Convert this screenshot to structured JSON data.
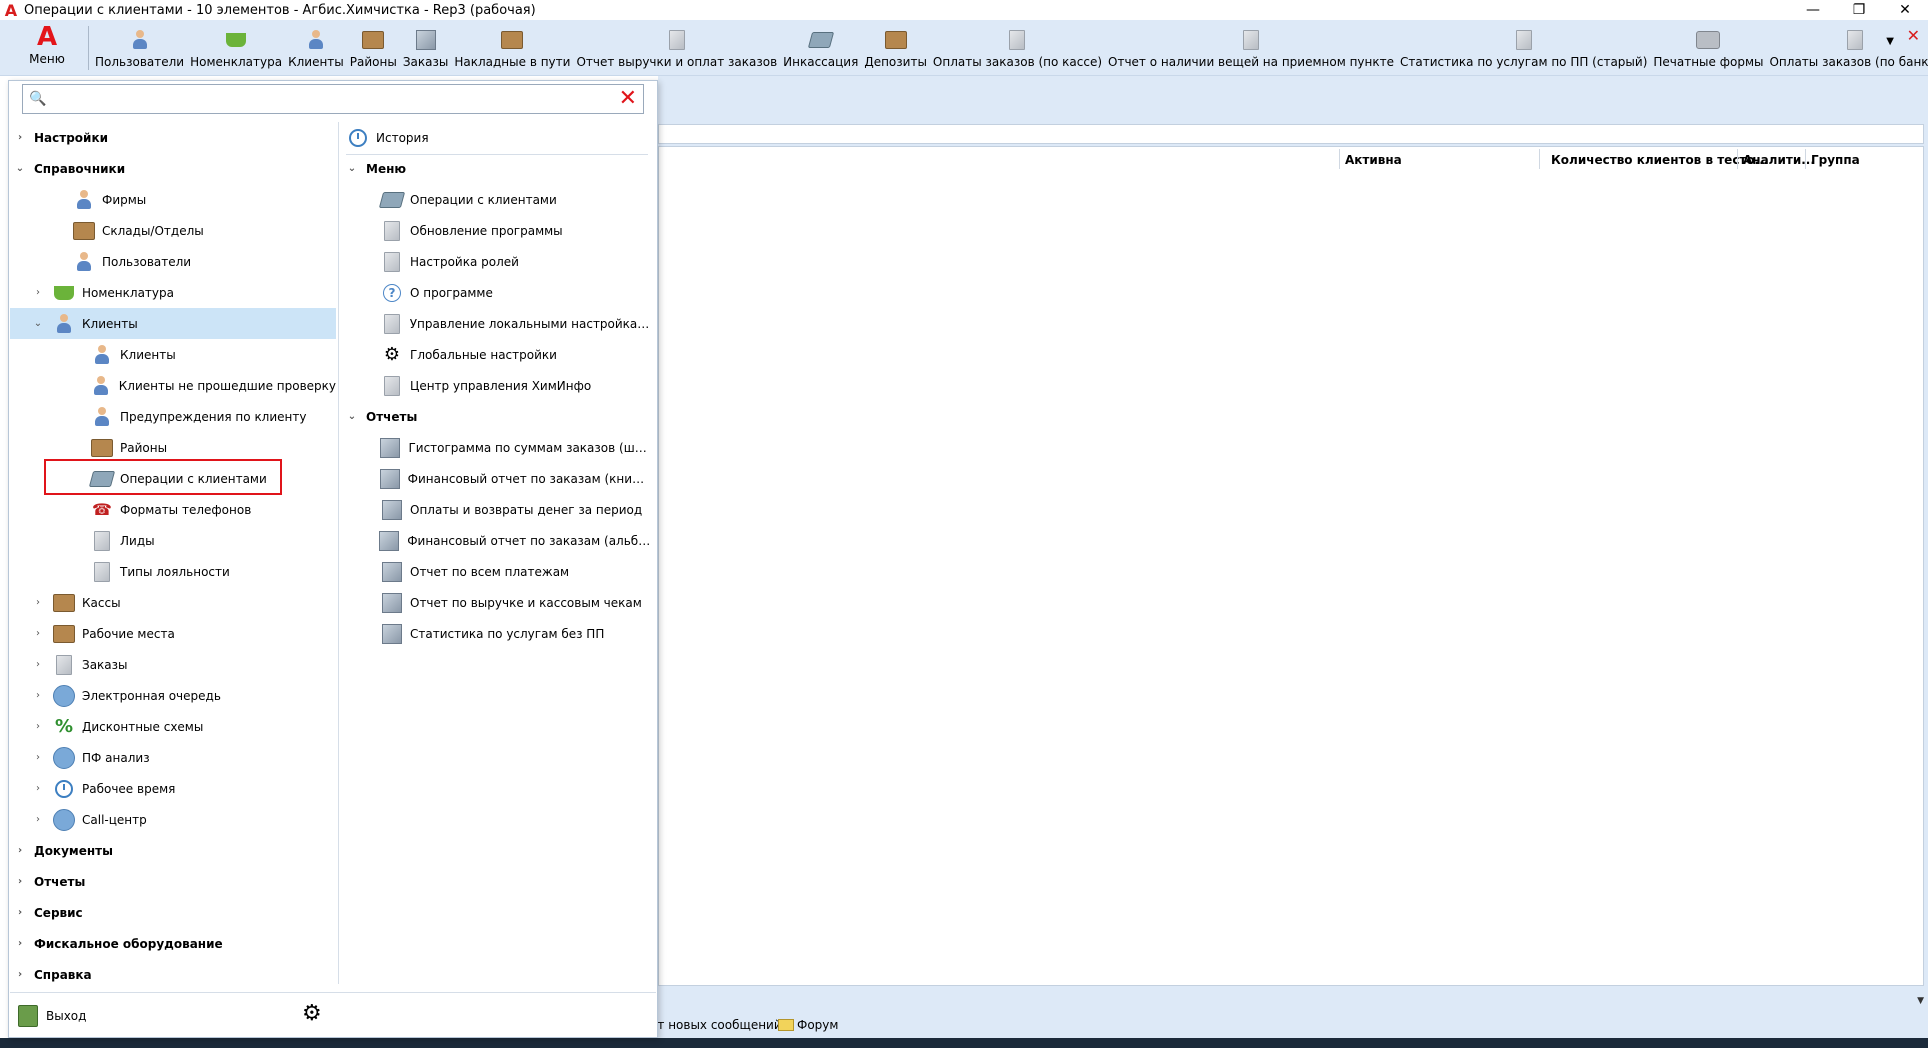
{
  "window": {
    "title": "Операции с клиентами - 10 элементов - Агбис.Химчистка - Rep3 (рабочая)",
    "controls": [
      "—",
      "❐",
      "✕"
    ]
  },
  "toolbar": {
    "menu_label": "Меню",
    "items": [
      {
        "label": "Пользователи",
        "icon": "users-icon"
      },
      {
        "label": "Номенклатура",
        "icon": "basket-icon"
      },
      {
        "label": "Клиенты",
        "icon": "client-icon"
      },
      {
        "label": "Районы",
        "icon": "district-icon"
      },
      {
        "label": "Заказы",
        "icon": "orders-icon"
      },
      {
        "label": "Накладные в пути",
        "icon": "truck-icon"
      },
      {
        "label": "Отчет выручки и оплат заказов",
        "icon": "document-icon"
      },
      {
        "label": "Инкассация",
        "icon": "cash-icon"
      },
      {
        "label": "Депозиты",
        "icon": "deposit-icon"
      },
      {
        "label": "Оплаты заказов (по кассе)",
        "icon": "document-icon"
      },
      {
        "label": "Отчет о наличии вещей на приемном пункте",
        "icon": "document-icon"
      },
      {
        "label": "Статистика по услугам по ПП (старый)",
        "icon": "document-icon"
      },
      {
        "label": "Печатные формы",
        "icon": "printer-icon"
      },
      {
        "label": "Оплаты заказов (по банку)",
        "icon": "document-icon"
      }
    ]
  },
  "search": {
    "value": "",
    "placeholder": ""
  },
  "tree": {
    "items": [
      {
        "label": "Настройки",
        "level": 0,
        "chev": "›",
        "bold": true
      },
      {
        "label": "Справочники",
        "level": 0,
        "chev": "⌄",
        "bold": true
      },
      {
        "label": "Фирмы",
        "level": 2,
        "icon": "firm-icon"
      },
      {
        "label": "Склады/Отделы",
        "level": 2,
        "icon": "warehouse-icon"
      },
      {
        "label": "Пользователи",
        "level": 2,
        "icon": "users-icon"
      },
      {
        "label": "Номенклатура",
        "level": 1,
        "chev": "›",
        "icon": "basket-icon"
      },
      {
        "label": "Клиенты",
        "level": 1,
        "chev": "⌄",
        "icon": "client-icon",
        "selected": true
      },
      {
        "label": "Клиенты",
        "level": 3,
        "icon": "client-icon"
      },
      {
        "label": "Клиенты не прошедшие проверку",
        "level": 3,
        "icon": "client-warning-icon"
      },
      {
        "label": "Предупреждения по клиенту",
        "level": 3,
        "icon": "client-alert-icon"
      },
      {
        "label": "Районы",
        "level": 3,
        "icon": "district-icon"
      },
      {
        "label": "Операции с клиентами",
        "level": 3,
        "icon": "cash-icon"
      },
      {
        "label": "Форматы телефонов",
        "level": 3,
        "icon": "phone-icon"
      },
      {
        "label": "Лиды",
        "level": 3,
        "icon": "document-icon"
      },
      {
        "label": "Типы лояльности",
        "level": 3,
        "icon": "document-icon"
      },
      {
        "label": "Кассы",
        "level": 1,
        "chev": "›",
        "icon": "register-icon"
      },
      {
        "label": "Рабочие места",
        "level": 1,
        "chev": "›",
        "icon": "workplace-icon"
      },
      {
        "label": "Заказы",
        "level": 1,
        "chev": "›",
        "icon": "document-icon"
      },
      {
        "label": "Электронная очередь",
        "level": 1,
        "chev": "›",
        "icon": "queue-icon"
      },
      {
        "label": "Дисконтные схемы",
        "level": 1,
        "chev": "›",
        "icon": "percent-icon"
      },
      {
        "label": "ПФ анализ",
        "level": 1,
        "chev": "›",
        "icon": "analysis-icon"
      },
      {
        "label": "Рабочее время",
        "level": 1,
        "chev": "›",
        "icon": "clock-icon"
      },
      {
        "label": "Call-центр",
        "level": 1,
        "chev": "›",
        "icon": "phone-round-icon"
      },
      {
        "label": "Документы",
        "level": 0,
        "chev": "›",
        "bold": true
      },
      {
        "label": "Отчеты",
        "level": 0,
        "chev": "›",
        "bold": true
      },
      {
        "label": "Сервис",
        "level": 0,
        "chev": "›",
        "bold": true
      },
      {
        "label": "Фискальное оборудование",
        "level": 0,
        "chev": "›",
        "bold": true
      },
      {
        "label": "Справка",
        "level": 0,
        "chev": "›",
        "bold": true
      }
    ]
  },
  "right_panel": {
    "history_label": "История",
    "menu_section": "Меню",
    "menu_items": [
      {
        "label": "Операции с клиентами",
        "icon": "cash-icon"
      },
      {
        "label": "Обновление программы",
        "icon": "document-icon"
      },
      {
        "label": "Настройка ролей",
        "icon": "document-icon"
      },
      {
        "label": "О программе",
        "icon": "question-icon"
      },
      {
        "label": "Управление локальными настройками",
        "icon": "document-icon"
      },
      {
        "label": "Глобальные настройки",
        "icon": "settings-icon"
      },
      {
        "label": "Центр управления ХимИнфо",
        "icon": "document-icon"
      }
    ],
    "reports_section": "Отчеты",
    "report_items": [
      {
        "label": "Гистограмма по суммам заказов (шаг ...",
        "icon": "report-icon"
      },
      {
        "label": "Финансовый отчет по заказам (книжная)",
        "icon": "report-icon"
      },
      {
        "label": "Оплаты и возвраты денег за период",
        "icon": "report-icon"
      },
      {
        "label": "Финансовый отчет по заказам (альбомн...",
        "icon": "report-icon"
      },
      {
        "label": "Отчет по всем платежам",
        "icon": "report-icon"
      },
      {
        "label": "Отчет по выручке и кассовым чекам",
        "icon": "report-icon"
      },
      {
        "label": "Статистика по услугам без ПП",
        "icon": "report-icon"
      }
    ]
  },
  "grid": {
    "columns": [
      "Активна",
      "Количество клиентов в тесто...",
      "Аналити...",
      "Группа"
    ]
  },
  "status": {
    "messages": "ет новых сообщений",
    "forum": "Форум"
  },
  "panel_bottom": {
    "exit_label": "Выход"
  },
  "colors": {
    "accent_red": "#e0141a",
    "toolbar_bg": "#dde9f7",
    "selection_bg": "#cce4f7"
  }
}
